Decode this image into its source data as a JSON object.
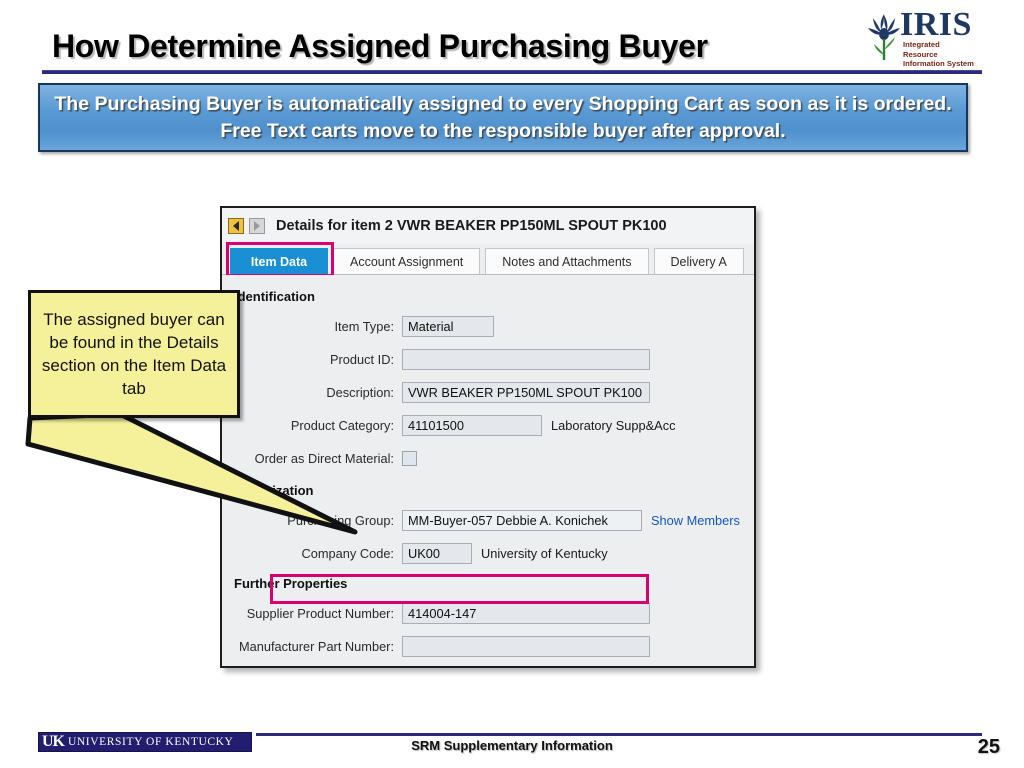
{
  "slide": {
    "title": "How Determine Assigned Purchasing Buyer",
    "banner_text": "The Purchasing Buyer is automatically assigned to every Shopping Cart as soon as it is ordered. Free Text carts move to the responsible buyer after approval.",
    "accent_blue": "#5b9bd5",
    "accent_navy": "#2b2b7a",
    "highlight_magenta": "#d6006e",
    "callout_yellow": "#f5f09a"
  },
  "logo": {
    "wordmark": "IRIS",
    "subtitle_line1": "Integrated Resource",
    "subtitle_line2": "Information System"
  },
  "dialog": {
    "title": "Details for item 2  VWR BEAKER PP150ML SPOUT PK100",
    "prev_label": "◀",
    "next_label": "▶",
    "tabs": [
      {
        "label": "Item Data",
        "active": true
      },
      {
        "label": "Account Assignment",
        "active": false
      },
      {
        "label": "Notes and Attachments",
        "active": false
      },
      {
        "label": "Delivery A",
        "active": false
      }
    ],
    "sections": [
      {
        "heading": "Identification",
        "fields": [
          {
            "label": "Item Type:",
            "value": "Material",
            "tail": ""
          },
          {
            "label": "Product ID:",
            "value": "",
            "tail": ""
          },
          {
            "label": "Description:",
            "value": "VWR BEAKER PP150ML SPOUT PK100",
            "tail": ""
          },
          {
            "label": "Product Category:",
            "value": "41101500",
            "tail": "Laboratory Supp&Acc"
          },
          {
            "label": "Order as Direct Material:",
            "value": "",
            "tail": ""
          }
        ]
      },
      {
        "heading": "Organization",
        "fields": [
          {
            "label": "Purchasing Group:",
            "value": "MM-Buyer-057 Debbie A. Konichek",
            "tail": "Show Members"
          },
          {
            "label": "Company Code:",
            "value": "UK00",
            "tail": "University of Kentucky"
          }
        ]
      },
      {
        "heading": "Further Properties",
        "fields": [
          {
            "label": "Supplier Product Number:",
            "value": "414004-147",
            "tail": ""
          },
          {
            "label": "Manufacturer Part Number:",
            "value": "",
            "tail": ""
          }
        ]
      }
    ]
  },
  "callout": {
    "text": "The assigned buyer can be found in the Details section on the Item Data tab"
  },
  "footer": {
    "uk_mark": "UK",
    "uk_name": "UNIVERSITY OF KENTUCKY",
    "center_text": "SRM Supplementary Information",
    "page_number": "25"
  }
}
